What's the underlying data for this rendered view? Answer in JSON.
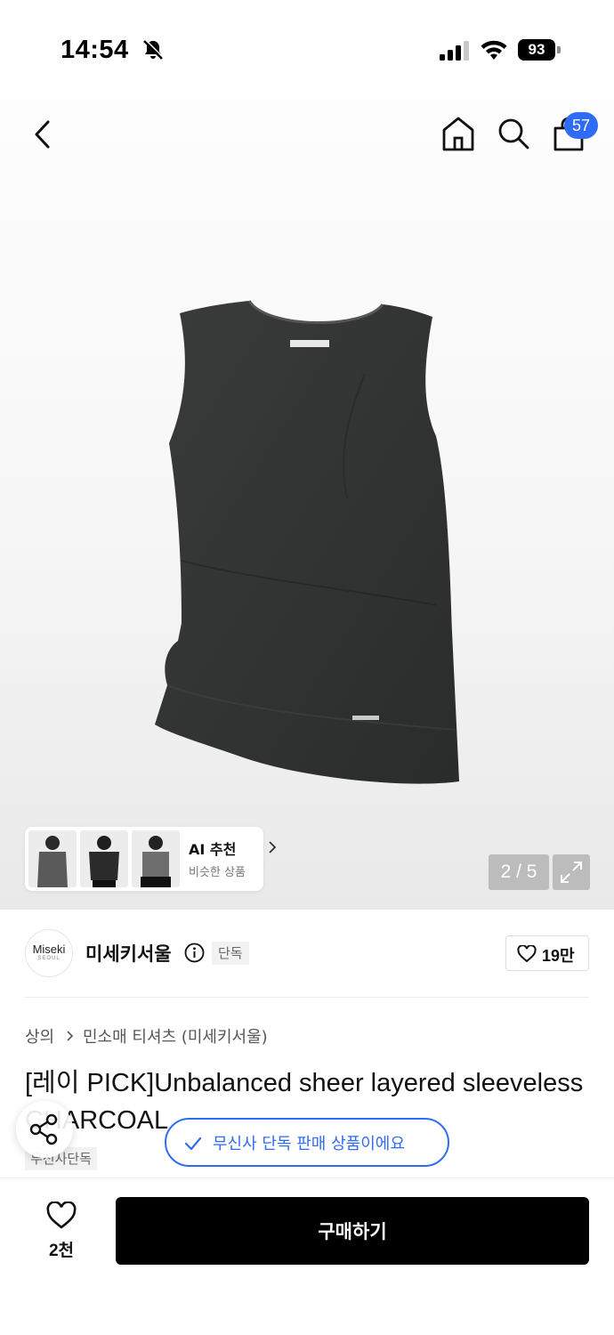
{
  "status_bar": {
    "time": "14:54",
    "battery": "93"
  },
  "header": {
    "cart_count": "57"
  },
  "gallery": {
    "position": "2 / 5"
  },
  "ai_recommend": {
    "title": "AI 추천",
    "subtitle": "비슷한 상품"
  },
  "brand": {
    "logo_line1": "Miseki",
    "logo_line2": "SEOUL",
    "name": "미세키서울",
    "tag": "단독",
    "likes": "19만"
  },
  "category": {
    "level1": "상의",
    "level2": "민소매 티셔츠 (미세키서울)"
  },
  "product": {
    "title": "[레이 PICK]Unbalanced sheer layered sleeveless CHARCOAL",
    "exclusive_label": "무신사단독"
  },
  "toast": {
    "text": "무신사 단독 판매 상품이에요"
  },
  "bottom_bar": {
    "wish_count": "2천",
    "buy_label": "구매하기"
  },
  "colors": {
    "accent": "#2f6cf5",
    "buy_button": "#000000"
  }
}
